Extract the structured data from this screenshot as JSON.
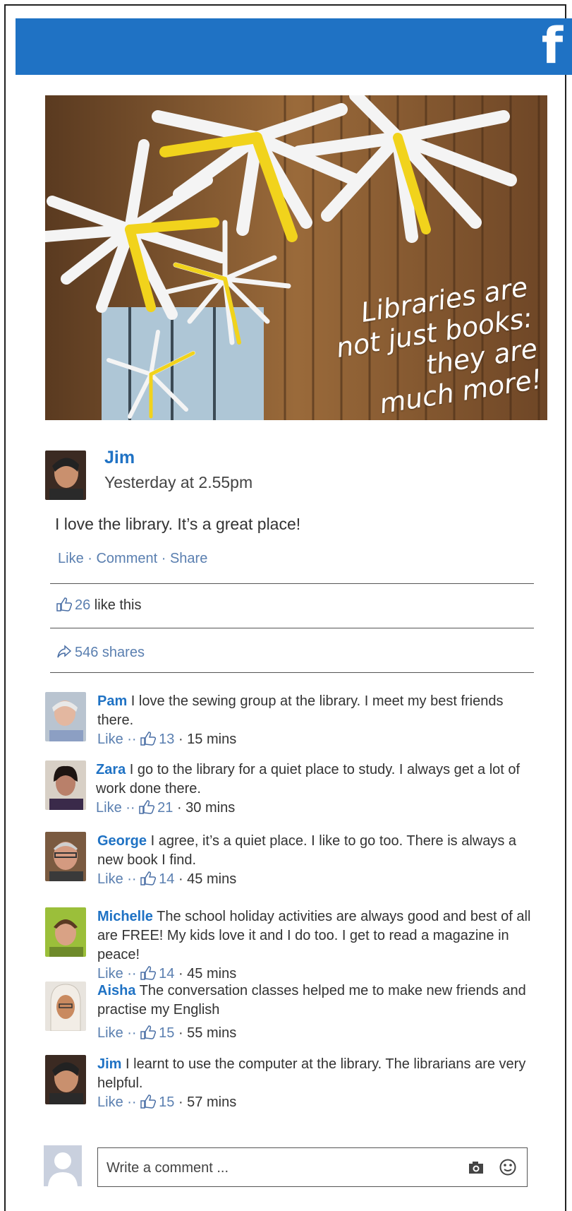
{
  "brand": {
    "logo_letter": "f",
    "bar_color": "#1f72c4"
  },
  "banner": {
    "caption_lines": [
      "Libraries are",
      "not just books:",
      "they are",
      "much more!"
    ]
  },
  "post": {
    "author": "Jim",
    "time": "Yesterday at 2.55pm",
    "text": "I love the library. It’s a great place!",
    "actions": {
      "like": "Like",
      "sep1": " · ",
      "comment": "Comment",
      "sep2": " · ",
      "share": "Share"
    },
    "likes_count": "26",
    "likes_suffix": " like this",
    "shares": "546 shares"
  },
  "comments": [
    {
      "name": "Pam",
      "text": " I love the sewing group at the library. I meet my best friends there.",
      "like": "Like",
      "dots": " ·· ",
      "count": "13",
      "time": " · 15 mins"
    },
    {
      "name": "Zara",
      "text": " I go to the library for a quiet place to study. I always get a lot of work done there.",
      "like": "Like",
      "dots": " ·· ",
      "count": "21",
      "time": " · 30 mins"
    },
    {
      "name": "George",
      "text": " I agree, it’s a quiet place. I like to go too. There is always a new book I find.",
      "like": "Like",
      "dots": " ·· ",
      "count": "14",
      "time": " · 45 mins"
    },
    {
      "name": "Michelle",
      "text": " The school holiday activities are always good and best of all are FREE! My kids love it and I do too. I get to read a magazine in peace!",
      "like": "Like",
      "dots": " ·· ",
      "count": "14",
      "time": " · 45 mins"
    },
    {
      "name": "Aisha",
      "text": " The conversation classes helped me to make new friends and practise my English",
      "like": "Like",
      "dots": " ·· ",
      "count": "15",
      "time": " · 55 mins"
    },
    {
      "name": "Jim",
      "text": " I learnt to use the computer at the library. The librarians are very helpful.",
      "like": "Like",
      "dots": " ·· ",
      "count": "15",
      "time": " · 57 mins"
    }
  ],
  "composer": {
    "placeholder": "Write a comment ...",
    "icons": [
      "camera-icon",
      "smiley-icon"
    ]
  }
}
